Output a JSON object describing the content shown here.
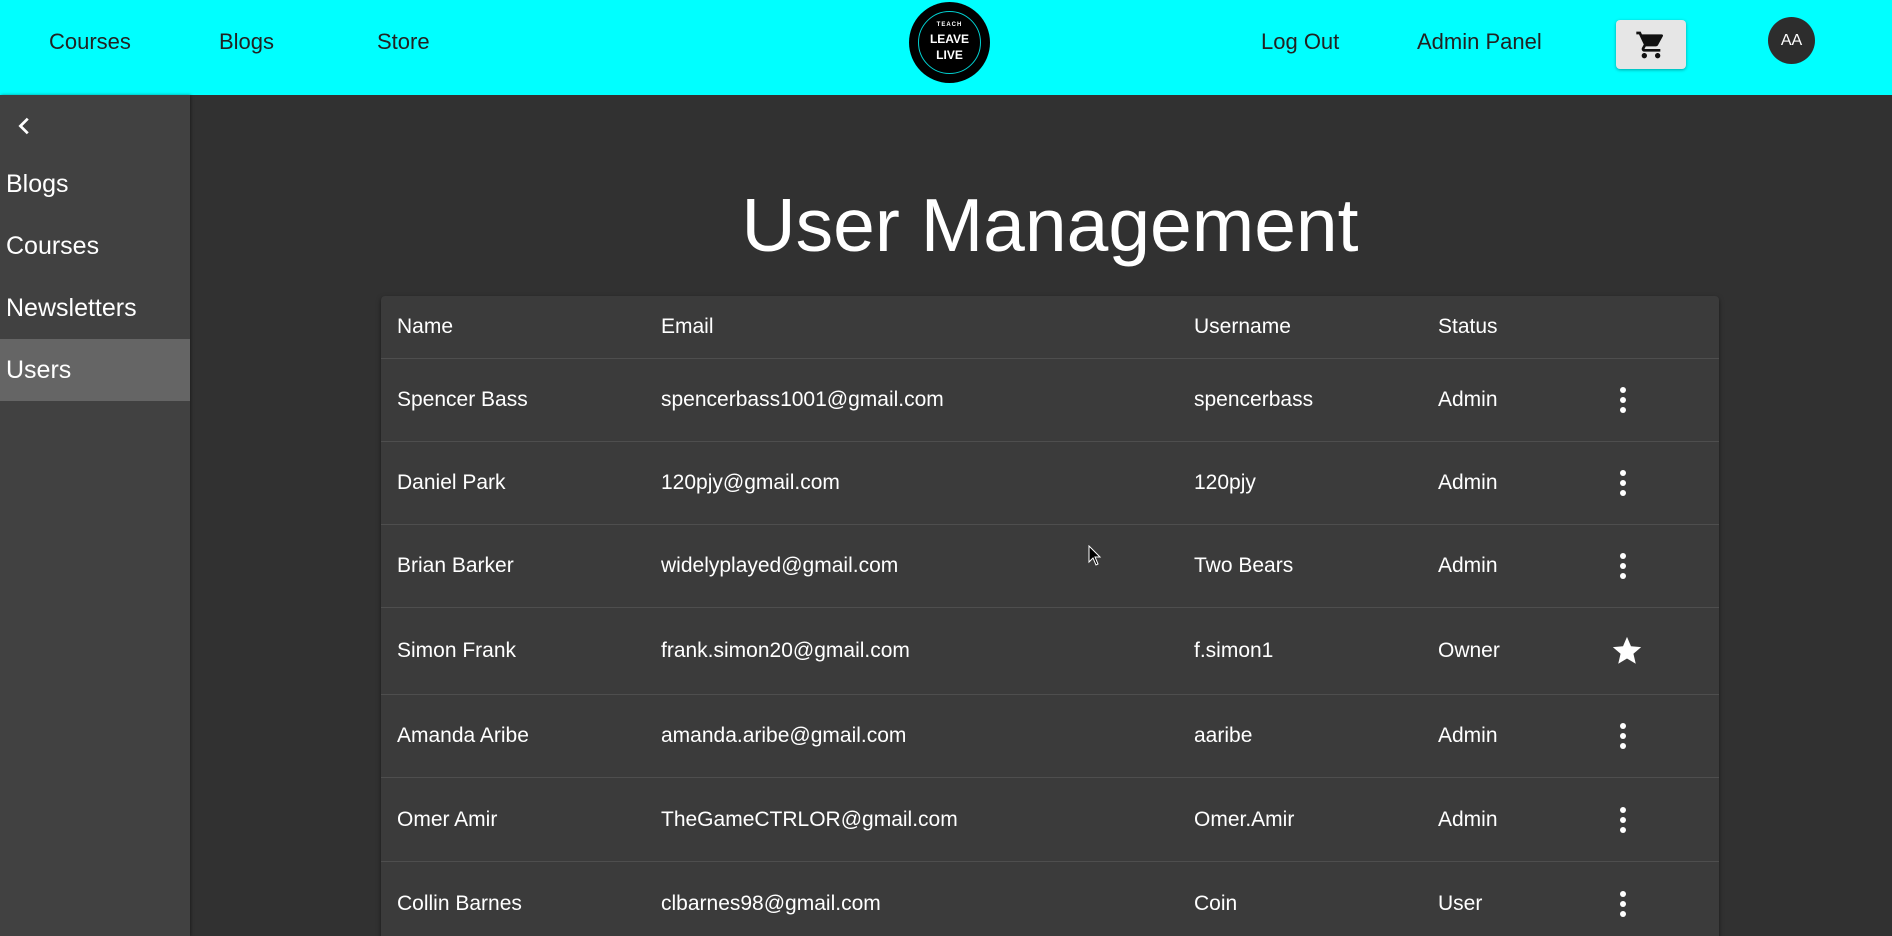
{
  "topbar": {
    "nav_left": [
      "Courses",
      "Blogs",
      "Store"
    ],
    "logo": {
      "small": "TEACH",
      "line1": "LEAVE",
      "line2": "LIVE"
    },
    "nav_right": [
      "Log Out",
      "Admin Panel"
    ],
    "cart_icon": "shopping-cart-icon",
    "avatar_initials": "AA"
  },
  "sidebar": {
    "collapse_icon": "chevron-left-icon",
    "items": [
      {
        "label": "Blogs"
      },
      {
        "label": "Courses"
      },
      {
        "label": "Newsletters"
      },
      {
        "label": "Users",
        "active": true
      }
    ]
  },
  "page_title": "User Management",
  "table": {
    "columns": [
      "Name",
      "Email",
      "Username",
      "Status"
    ],
    "rows": [
      {
        "name": "Spencer Bass",
        "email": "spencerbass1001@gmail.com",
        "username": "spencerbass",
        "status": "Admin",
        "action_icon": "more-vertical-icon"
      },
      {
        "name": "Daniel Park",
        "email": "120pjy@gmail.com",
        "username": "120pjy",
        "status": "Admin",
        "action_icon": "more-vertical-icon"
      },
      {
        "name": "Brian Barker",
        "email": "widelyplayed@gmail.com",
        "username": "Two Bears",
        "status": "Admin",
        "action_icon": "more-vertical-icon"
      },
      {
        "name": "Simon Frank",
        "email": "frank.simon20@gmail.com",
        "username": "f.simon1",
        "status": "Owner",
        "action_icon": "star-icon"
      },
      {
        "name": "Amanda Aribe",
        "email": "amanda.aribe@gmail.com",
        "username": "aaribe",
        "status": "Admin",
        "action_icon": "more-vertical-icon"
      },
      {
        "name": "Omer Amir",
        "email": "TheGameCTRLOR@gmail.com",
        "username": "Omer.Amir",
        "status": "Admin",
        "action_icon": "more-vertical-icon"
      },
      {
        "name": "Collin Barnes",
        "email": "clbarnes98@gmail.com",
        "username": "Coin",
        "status": "User",
        "action_icon": "more-vertical-icon"
      }
    ]
  },
  "colors": {
    "topbar_bg": "#00ffff",
    "page_bg": "#313131",
    "sidebar_bg": "#414141",
    "sidebar_active_bg": "#656565",
    "table_bg": "#3b3b3b"
  }
}
